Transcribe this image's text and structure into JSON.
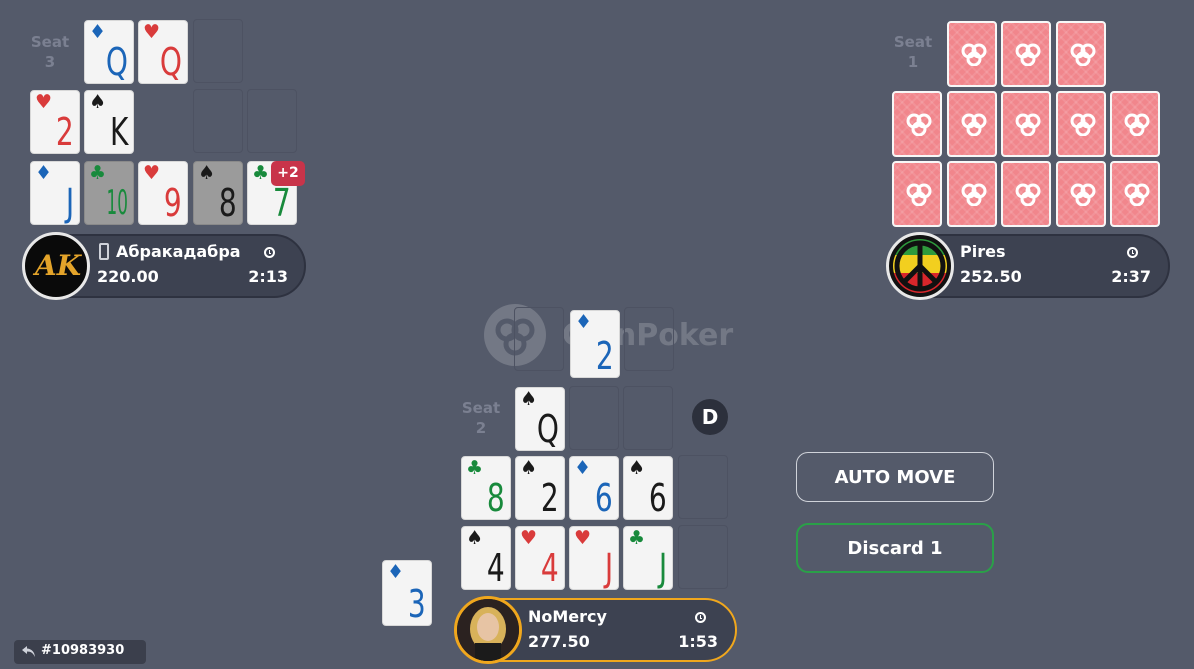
{
  "colors": {
    "table_bg": "#545a6a",
    "card_back": "#f1868c",
    "active_border": "#f0a71d",
    "discard_border": "#2aa048",
    "badge": "#c8344a"
  },
  "watermark": {
    "text": "CoinPoker"
  },
  "seats": {
    "seat3": {
      "label_line1": "Seat",
      "label_line2": "3",
      "player_name": "Абракадабра",
      "stack": "220.00",
      "time": "2:13",
      "avatar_text": "AK",
      "device_icon": "mobile-phone-icon",
      "extra_badge": "+2",
      "top_row": [
        {
          "rank": "Q",
          "suit": "♦",
          "color": "blue"
        },
        {
          "rank": "Q",
          "suit": "♥",
          "color": "red"
        }
      ],
      "middle_row": [
        {
          "rank": "2",
          "suit": "♥",
          "color": "red"
        },
        {
          "rank": "K",
          "suit": "♠",
          "color": "black"
        }
      ],
      "bottom_row": [
        {
          "rank": "J",
          "suit": "♦",
          "color": "blue"
        },
        {
          "rank": "10",
          "suit": "♣",
          "color": "green"
        },
        {
          "rank": "9",
          "suit": "♥",
          "color": "red"
        },
        {
          "rank": "8",
          "suit": "♠",
          "color": "black"
        },
        {
          "rank": "7",
          "suit": "♣",
          "color": "green"
        }
      ]
    },
    "seat1": {
      "label_line1": "Seat",
      "label_line2": "1",
      "player_name": "Pires",
      "stack": "252.50",
      "time": "2:37",
      "avatar_icon": "peace-sign-icon"
    },
    "seat2": {
      "label_line1": "Seat",
      "label_line2": "2",
      "player_name": "NoMercy",
      "stack": "277.50",
      "time": "1:53",
      "dealer_button": "D",
      "dealt_card": {
        "rank": "2",
        "suit": "♦",
        "color": "blue"
      },
      "top_row": [
        {
          "rank": "Q",
          "suit": "♠",
          "color": "black"
        }
      ],
      "middle_row": [
        {
          "rank": "8",
          "suit": "♣",
          "color": "green"
        },
        {
          "rank": "2",
          "suit": "♠",
          "color": "black"
        },
        {
          "rank": "6",
          "suit": "♦",
          "color": "blue"
        },
        {
          "rank": "6",
          "suit": "♠",
          "color": "black"
        }
      ],
      "bottom_row": [
        {
          "rank": "4",
          "suit": "♠",
          "color": "black"
        },
        {
          "rank": "4",
          "suit": "♥",
          "color": "red"
        },
        {
          "rank": "J",
          "suit": "♥",
          "color": "red"
        },
        {
          "rank": "J",
          "suit": "♣",
          "color": "green"
        }
      ],
      "discard_card": {
        "rank": "3",
        "suit": "♦",
        "color": "blue"
      }
    }
  },
  "buttons": {
    "auto_move": "AUTO MOVE",
    "discard": "Discard 1"
  },
  "hand_id": "#10983930"
}
